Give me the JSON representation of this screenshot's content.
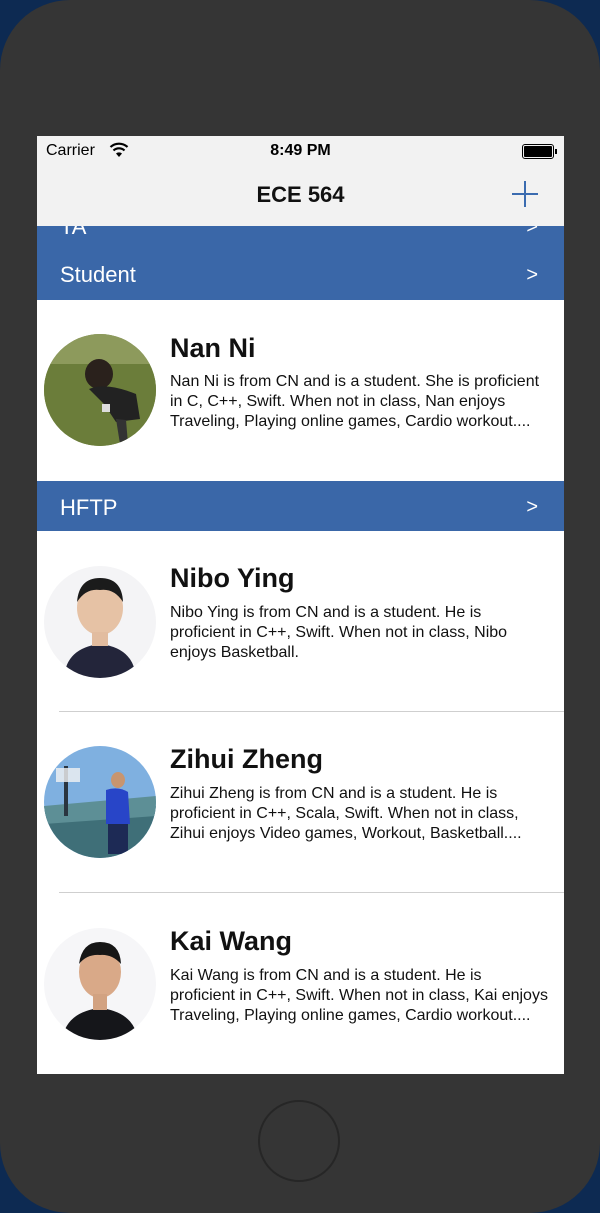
{
  "status_bar": {
    "carrier": "Carrier",
    "time": "8:49 PM"
  },
  "nav": {
    "title": "ECE 564",
    "add_icon": "plus-icon"
  },
  "sections": [
    {
      "title": "TA",
      "arrow": ">"
    },
    {
      "title": "Student",
      "arrow": ">"
    },
    {
      "title": "HFTP",
      "arrow": ">"
    }
  ],
  "people": [
    {
      "name": "Nan Ni",
      "description": "Nan Ni is from CN and is a student. She is proficient in C, C++, Swift. When not in class, Nan enjoys Traveling, Playing online games, Cardio workout...."
    },
    {
      "name": "Nibo Ying",
      "description": "Nibo Ying is from CN and is a student. He is proficient in C++, Swift. When not in class, Nibo enjoys Basketball."
    },
    {
      "name": "Zihui Zheng",
      "description": "Zihui Zheng is from CN and is a student. He is proficient in C++, Scala, Swift. When not in class, Zihui enjoys Video games, Workout, Basketball...."
    },
    {
      "name": "Kai Wang",
      "description": "Kai Wang is from CN and is a student. He is proficient in C++, Swift. When not in class, Kai enjoys Traveling, Playing online games, Cardio workout...."
    }
  ],
  "colors": {
    "section_header": "#3a67a8",
    "accent": "#3b6cb0",
    "phone_body": "#353535"
  }
}
